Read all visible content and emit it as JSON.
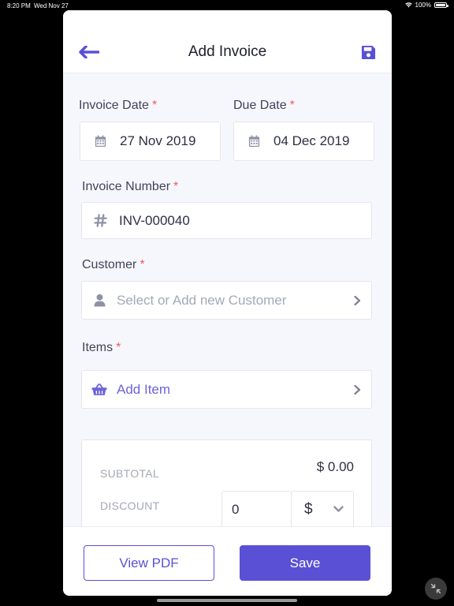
{
  "status_bar": {
    "time": "8:20 PM",
    "date": "Wed Nov 27",
    "battery": "100%"
  },
  "header": {
    "title": "Add Invoice",
    "back_icon": "arrow-left-icon",
    "save_icon": "floppy-disk-icon"
  },
  "form": {
    "required_marker": "*",
    "invoice_date": {
      "label": "Invoice Date",
      "value": "27 Nov 2019",
      "icon": "calendar-icon"
    },
    "due_date": {
      "label": "Due Date",
      "value": "04 Dec 2019",
      "icon": "calendar-icon"
    },
    "invoice_number": {
      "label": "Invoice Number",
      "value": "INV-000040",
      "icon": "hash-icon"
    },
    "customer": {
      "label": "Customer",
      "placeholder": "Select or Add new Customer",
      "icon": "user-icon"
    },
    "items": {
      "label": "Items",
      "action": "Add Item",
      "icon": "basket-icon"
    }
  },
  "totals": {
    "subtotal_label": "SUBTOTAL",
    "subtotal_value": "$ 0.00",
    "discount_label": "DISCOUNT",
    "discount_value": "0",
    "discount_type": "$"
  },
  "footer": {
    "view_pdf_label": "View PDF",
    "save_label": "Save"
  },
  "colors": {
    "primary": "#5a50d6",
    "required": "#ef5b5b",
    "background": "#f6f7fc"
  }
}
